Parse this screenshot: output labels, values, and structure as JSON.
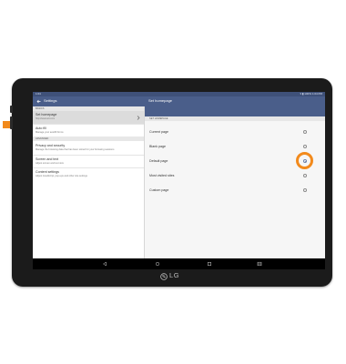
{
  "colors": {
    "accent_orange": "#f28a1c",
    "toolbar_blue": "#4a5e8a",
    "statusbar_blue": "#3f5179",
    "bezel": "#1b1b1b"
  },
  "status_bar": {
    "time": "1:04",
    "right_text": "▾ ▮ 100% 1:04 PM"
  },
  "left_panel": {
    "title": "Settings",
    "sections": [
      {
        "header": "BASICS",
        "items": [
          {
            "title": "Set homepage",
            "subtitle": "http://www.att.com",
            "selected": true
          },
          {
            "title": "Auto fill",
            "subtitle": "Manage your autofill forms",
            "selected": false
          }
        ]
      },
      {
        "header": "ADVANCED",
        "items": [
          {
            "title": "Privacy and security",
            "subtitle": "Manage the browsing data that has been stored for your browsing sessions",
            "selected": false
          },
          {
            "title": "Screen and text",
            "subtitle": "Adjust screen and text size",
            "selected": false
          },
          {
            "title": "Content settings",
            "subtitle": "Adjust JavaScript, pop-ups and other site settings",
            "selected": false
          }
        ]
      }
    ]
  },
  "right_panel": {
    "title": "Set homepage",
    "section_header": "SET HOMEPAGE",
    "options": [
      {
        "label": "Current page",
        "checked": false
      },
      {
        "label": "Blank page",
        "checked": false
      },
      {
        "label": "Default page",
        "checked": true
      },
      {
        "label": "Most visited sites",
        "checked": false
      },
      {
        "label": "Custom page",
        "checked": false
      }
    ]
  },
  "brand": {
    "logo_text": "LG"
  }
}
